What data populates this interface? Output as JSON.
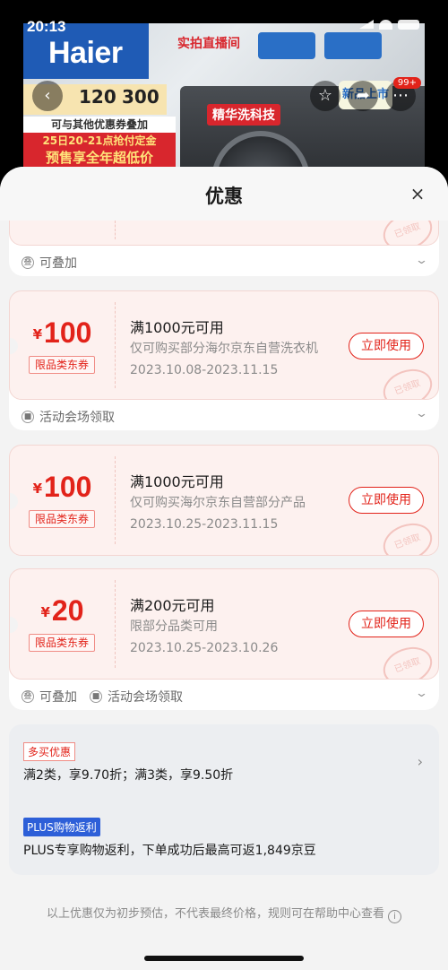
{
  "status_bar": {
    "time": "20:13"
  },
  "banner": {
    "brand": "Haier",
    "live_label": "实拍直播间",
    "plus_values": [
      "120",
      "300"
    ],
    "tagline": "可与其他优惠券叠加",
    "presale_line1": "25日20-21点抢付定金",
    "presale_line2": "预售享全年超低价",
    "tech_tag": "精华洗科技",
    "new_tag": "新品上市",
    "cart_badge": "99+"
  },
  "sheet": {
    "title": "优惠",
    "close_label": "×"
  },
  "partial_coupon": {
    "stamp": "已领取",
    "footer": "可叠加"
  },
  "coupons": [
    {
      "currency": "¥",
      "amount": "100",
      "tag": "限品类东券",
      "condition": "满1000元可用",
      "desc": "仅可购买部分海尔京东自营洗衣机",
      "date": "2023.10.08-2023.11.15",
      "button": "立即使用",
      "stamp": "已领取",
      "footer_items": [
        "活动会场领取"
      ]
    },
    {
      "currency": "¥",
      "amount": "100",
      "tag": "限品类东券",
      "condition": "满1000元可用",
      "desc": "仅可购买海尔京东自营部分产品",
      "date": "2023.10.25-2023.11.15",
      "button": "立即使用",
      "stamp": "已领取",
      "footer_items": []
    },
    {
      "currency": "¥",
      "amount": "20",
      "tag": "限品类东券",
      "condition": "满200元可用",
      "desc": "限部分品类可用",
      "date": "2023.10.25-2023.10.26",
      "button": "立即使用",
      "stamp": "已领取",
      "footer_items": [
        "可叠加",
        "活动会场领取"
      ]
    }
  ],
  "promotions": {
    "multi_tag": "多买优惠",
    "multi_text": "满2类，享9.70折；满3类，享9.50折",
    "plus_tag": "PLUS购物返利",
    "plus_text": "PLUS专享购物返利，下单成功后最高可返1,849京豆"
  },
  "disclaimer": "以上优惠仅为初步预估，不代表最终价格，规则可在帮助中心查看",
  "colors": {
    "accent": "#e2231a",
    "plus_blue": "#2d5fd8",
    "coupon_bg": "#fdf1ef"
  }
}
